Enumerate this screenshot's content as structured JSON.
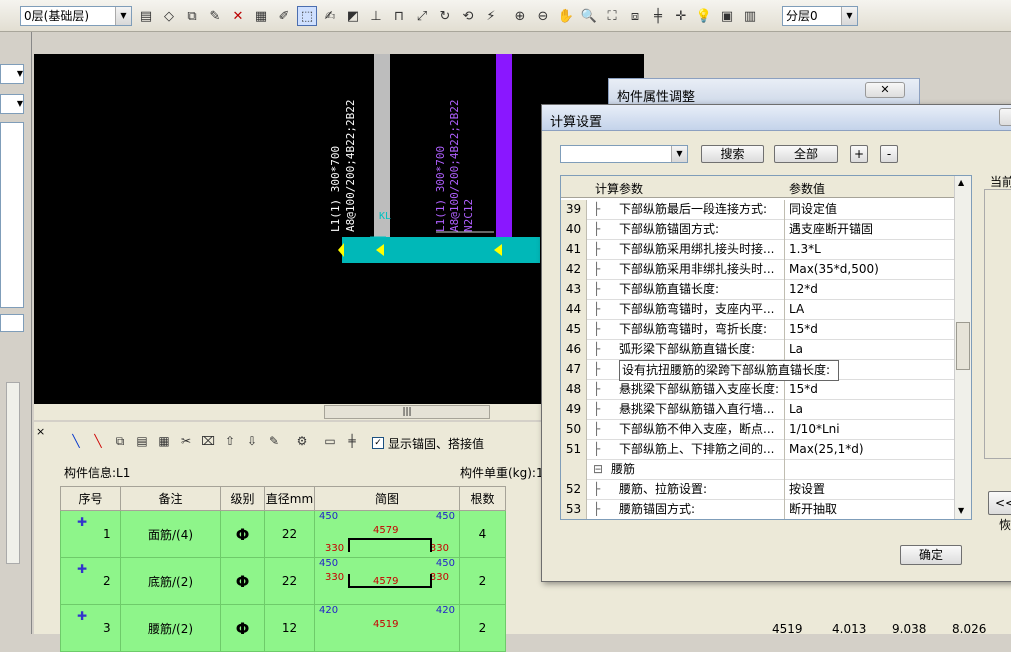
{
  "toolbar": {
    "floor_select": "0层(基础层)",
    "layer_select": "分层0"
  },
  "cad": {
    "beam1_label": "L1(1) 300*700",
    "beam1_rebar": "A8@100/200;4B22;2B22",
    "beam2_label": "L1(1) 300*700",
    "beam2_rebar": "A8@100/200;4B22;2B22",
    "beam2_extra": "N2C12",
    "kl_label": "KL"
  },
  "bottom": {
    "show_anchor_label": "显示锚固、搭接值",
    "component_info": "构件信息:L1",
    "unit_weight": "构件单重(kg):1",
    "columns": [
      "序号",
      "备注",
      "级别",
      "直径mm",
      "简图",
      "根数"
    ],
    "rows": [
      {
        "no": "1",
        "note": "面筋/(4)",
        "grade": "Φ",
        "dia": "22",
        "left_top": "450",
        "mid": "4579",
        "right_top": "450",
        "left_bottom": "330",
        "right_bottom": "330",
        "count": "4"
      },
      {
        "no": "2",
        "note": "底筋/(2)",
        "grade": "Φ",
        "dia": "22",
        "left_top": "450",
        "mid": "4579",
        "right_top": "450",
        "left_bottom": "330",
        "right_bottom": "330",
        "count": "2"
      },
      {
        "no": "3",
        "note": "腰筋/(2)",
        "grade": "Φ",
        "dia": "12",
        "left_top": "420",
        "mid": "4519",
        "right_top": "420",
        "left_bottom": "",
        "right_bottom": "",
        "count": "2"
      }
    ],
    "row3_values": [
      "4519",
      "4.013",
      "9.038",
      "8.026"
    ]
  },
  "bg_dialog": {
    "title": "构件属性调整"
  },
  "dialog": {
    "title": "计算设置",
    "search_label": "搜索",
    "all_label": "全部",
    "plus_label": "+",
    "minus_label": "-",
    "col_param": "计算参数",
    "col_value": "参数值",
    "right_label": "当前",
    "back_label": "<<恢",
    "ok_label": "确定",
    "rows": [
      {
        "no": "39",
        "name": "下部纵筋最后一段连接方式:",
        "value": "同设定值"
      },
      {
        "no": "40",
        "name": "下部纵筋锚固方式:",
        "value": "遇支座断开锚固"
      },
      {
        "no": "41",
        "name": "下部纵筋采用绑扎接头时接...",
        "value": "1.3*L"
      },
      {
        "no": "42",
        "name": "下部纵筋采用非绑扎接头时...",
        "value": "Max(35*d,500)"
      },
      {
        "no": "43",
        "name": "下部纵筋直锚长度:",
        "value": "12*d"
      },
      {
        "no": "44",
        "name": "下部纵筋弯锚时，支座内平...",
        "value": "LA"
      },
      {
        "no": "45",
        "name": "下部纵筋弯锚时，弯折长度:",
        "value": "15*d"
      },
      {
        "no": "46",
        "name": "弧形梁下部纵筋直锚长度:",
        "value": "La"
      },
      {
        "no": "47",
        "name": "设有抗扭腰筋的梁跨下部纵筋直锚长度:",
        "value": ""
      },
      {
        "no": "48",
        "name": "悬挑梁下部纵筋锚入支座长度:",
        "value": "15*d"
      },
      {
        "no": "49",
        "name": "悬挑梁下部纵筋锚入直行墙...",
        "value": "La"
      },
      {
        "no": "50",
        "name": "下部纵筋不伸入支座，断点...",
        "value": "1/10*Lni"
      },
      {
        "no": "51",
        "name": "下部纵筋上、下排筋之间的...",
        "value": "Max(25,1*d)"
      },
      {
        "no": "",
        "name": "腰筋",
        "value": ""
      },
      {
        "no": "52",
        "name": "腰筋、拉筋设置:",
        "value": "按设置"
      },
      {
        "no": "53",
        "name": "腰筋锚固方式:",
        "value": "断开抽取"
      }
    ]
  }
}
